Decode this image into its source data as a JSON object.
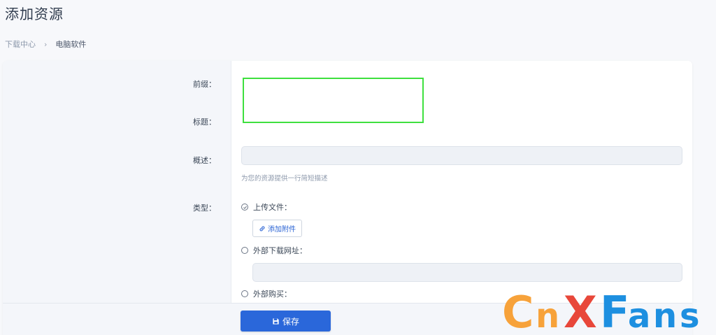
{
  "page": {
    "title": "添加资源"
  },
  "breadcrumb": {
    "parent": "下载中心",
    "separator": "›",
    "current": "电脑软件"
  },
  "form": {
    "prefix_label": "前缀：",
    "title_label": "标题：",
    "summary_label": "概述：",
    "summary_value": "",
    "summary_hint": "为您的资源提供一行简短描述",
    "type_label": "类型："
  },
  "type_options": {
    "upload": {
      "label": "上传文件：",
      "selected": true
    },
    "attach_button": "添加附件",
    "external_url": {
      "label": "外部下载网址：",
      "selected": false,
      "value": ""
    },
    "external_purchase": {
      "label": "外部购买：",
      "selected": false
    }
  },
  "footer": {
    "save_label": "保存"
  },
  "watermark": {
    "text": "CnXFans",
    "colors": {
      "orange": "#f7a23a",
      "red": "#e8473a",
      "blue": "#1d8fe0"
    }
  },
  "colors": {
    "primary": "#2a67da",
    "highlight": "#3ee03e"
  },
  "icons": {
    "check": "check-circle-icon",
    "link": "link-icon",
    "save": "save-icon",
    "chevron": "chevron-right-icon"
  }
}
